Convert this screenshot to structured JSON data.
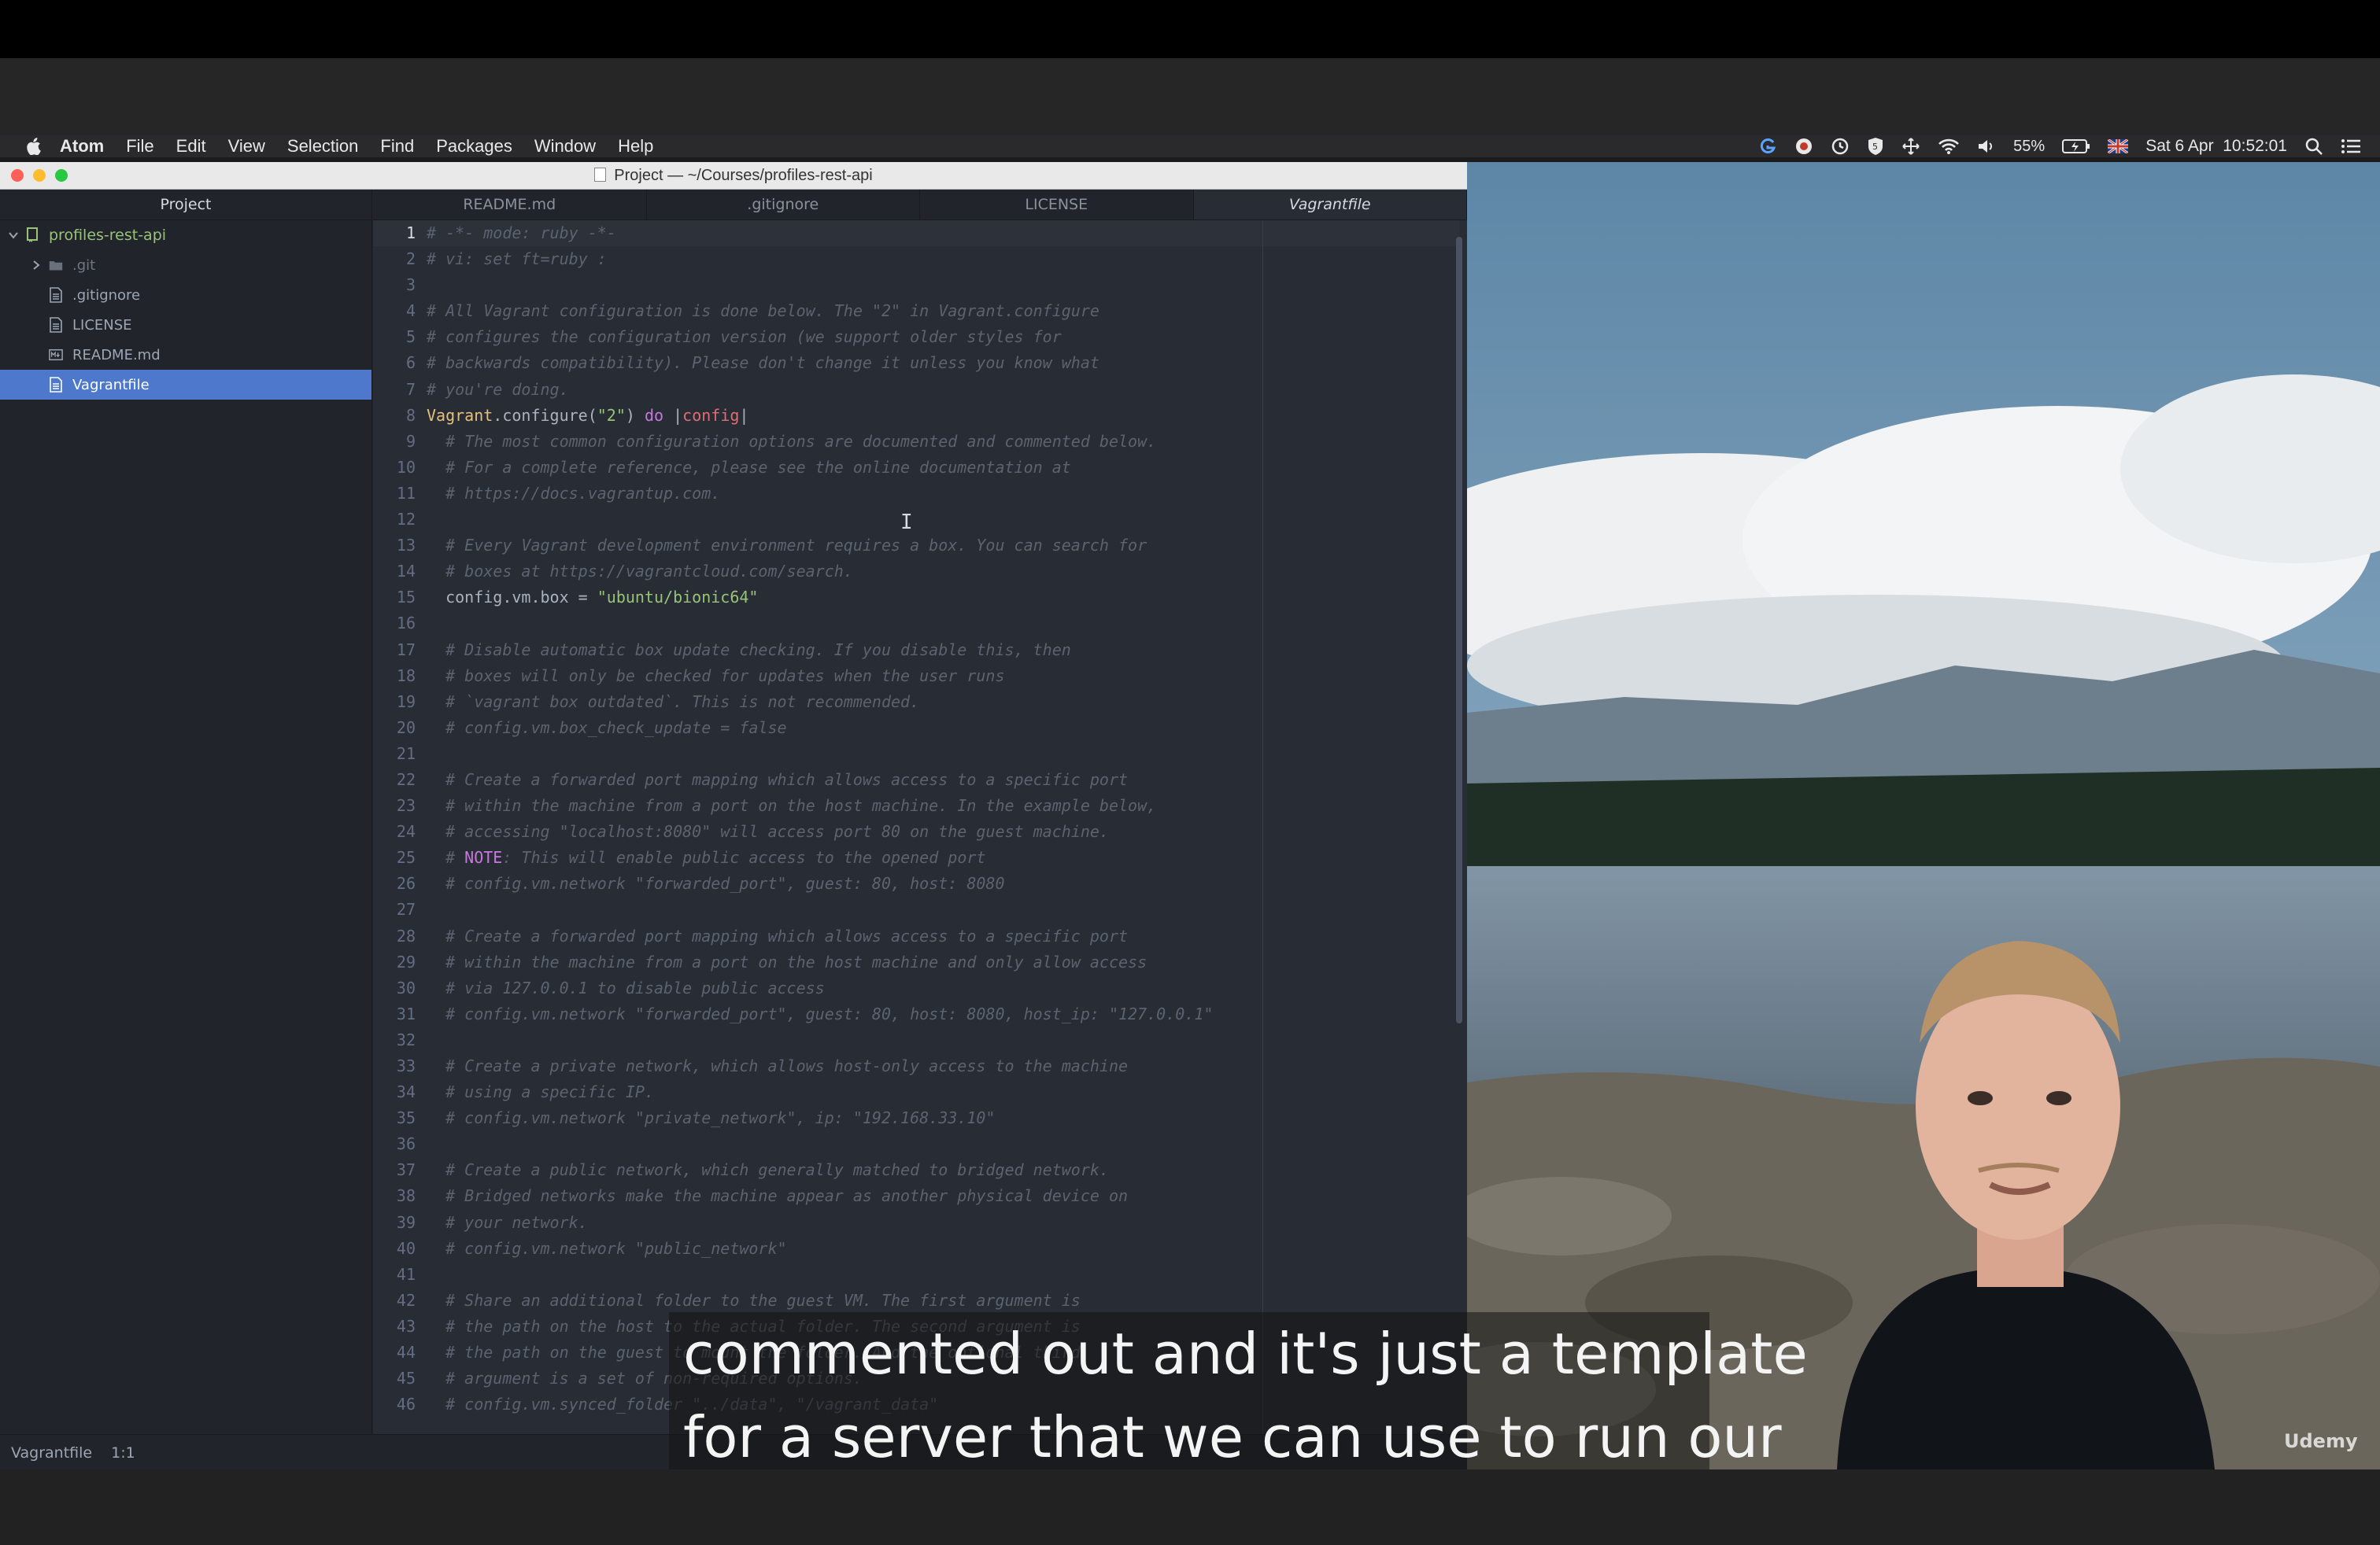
{
  "menubar": {
    "app_name": "Atom",
    "items": [
      "File",
      "Edit",
      "View",
      "Selection",
      "Find",
      "Packages",
      "Window",
      "Help"
    ],
    "battery": "55%",
    "datetime": "Sat 6 Apr  10:52:01"
  },
  "window": {
    "title": "Project — ~/Courses/profiles-rest-api"
  },
  "sidebar": {
    "header": "Project",
    "root": "profiles-rest-api",
    "items": [
      {
        "label": ".git",
        "type": "folder"
      },
      {
        "label": ".gitignore",
        "type": "file"
      },
      {
        "label": "LICENSE",
        "type": "file"
      },
      {
        "label": "README.md",
        "type": "markdown"
      },
      {
        "label": "Vagrantfile",
        "type": "file",
        "selected": true
      }
    ]
  },
  "tabs": [
    "README.md",
    ".gitignore",
    "LICENSE",
    "Vagrantfile"
  ],
  "active_tab": "Vagrantfile",
  "code": [
    [
      {
        "t": "# -*- mode: ruby -*-",
        "c": "cmt"
      }
    ],
    [
      {
        "t": "# vi: set ft=ruby :",
        "c": "cmt"
      }
    ],
    [],
    [
      {
        "t": "# All Vagrant configuration is done below. The \"2\" in Vagrant.configure",
        "c": "cmt"
      }
    ],
    [
      {
        "t": "# configures the configuration version (we support older styles for",
        "c": "cmt"
      }
    ],
    [
      {
        "t": "# backwards compatibility). Please don't change it unless you know what",
        "c": "cmt"
      }
    ],
    [
      {
        "t": "# you're doing.",
        "c": "cmt"
      }
    ],
    [
      {
        "t": "Vagrant",
        "c": "cls"
      },
      {
        "t": ".configure(",
        "c": "plain"
      },
      {
        "t": "\"2\"",
        "c": "str"
      },
      {
        "t": ") ",
        "c": "plain"
      },
      {
        "t": "do",
        "c": "kw"
      },
      {
        "t": " |",
        "c": "plain"
      },
      {
        "t": "config",
        "c": "var"
      },
      {
        "t": "|",
        "c": "plain"
      }
    ],
    [
      {
        "t": "  # The most common configuration options are documented and commented below.",
        "c": "cmt"
      }
    ],
    [
      {
        "t": "  # For a complete reference, please see the online documentation at",
        "c": "cmt"
      }
    ],
    [
      {
        "t": "  # https://docs.vagrantup.com.",
        "c": "cmt"
      }
    ],
    [],
    [
      {
        "t": "  # Every Vagrant development environment requires a box. You can search for",
        "c": "cmt"
      }
    ],
    [
      {
        "t": "  # boxes at https://vagrantcloud.com/search.",
        "c": "cmt"
      }
    ],
    [
      {
        "t": "  config.vm.box = ",
        "c": "plain"
      },
      {
        "t": "\"ubuntu/bionic64\"",
        "c": "str"
      }
    ],
    [],
    [
      {
        "t": "  # Disable automatic box update checking. If you disable this, then",
        "c": "cmt"
      }
    ],
    [
      {
        "t": "  # boxes will only be checked for updates when the user runs",
        "c": "cmt"
      }
    ],
    [
      {
        "t": "  # `vagrant box outdated`. This is not recommended.",
        "c": "cmt"
      }
    ],
    [
      {
        "t": "  # config.vm.box_check_update = false",
        "c": "cmt"
      }
    ],
    [],
    [
      {
        "t": "  # Create a forwarded port mapping which allows access to a specific port",
        "c": "cmt"
      }
    ],
    [
      {
        "t": "  # within the machine from a port on the host machine. In the example below,",
        "c": "cmt"
      }
    ],
    [
      {
        "t": "  # accessing \"localhost:8080\" will access port 80 on the guest machine.",
        "c": "cmt"
      }
    ],
    [
      {
        "t": "  # ",
        "c": "cmt"
      },
      {
        "t": "NOTE",
        "c": "kw"
      },
      {
        "t": ": This will enable public access to the opened port",
        "c": "cmt"
      }
    ],
    [
      {
        "t": "  # config.vm.network \"forwarded_port\", guest: 80, host: 8080",
        "c": "cmt"
      }
    ],
    [],
    [
      {
        "t": "  # Create a forwarded port mapping which allows access to a specific port",
        "c": "cmt"
      }
    ],
    [
      {
        "t": "  # within the machine from a port on the host machine and only allow access",
        "c": "cmt"
      }
    ],
    [
      {
        "t": "  # via 127.0.0.1 to disable public access",
        "c": "cmt"
      }
    ],
    [
      {
        "t": "  # config.vm.network \"forwarded_port\", guest: 80, host: 8080, host_ip: \"127.0.0.1\"",
        "c": "cmt"
      }
    ],
    [],
    [
      {
        "t": "  # Create a private network, which allows host-only access to the machine",
        "c": "cmt"
      }
    ],
    [
      {
        "t": "  # using a specific IP.",
        "c": "cmt"
      }
    ],
    [
      {
        "t": "  # config.vm.network \"private_network\", ip: \"192.168.33.10\"",
        "c": "cmt"
      }
    ],
    [],
    [
      {
        "t": "  # Create a public network, which generally matched to bridged network.",
        "c": "cmt"
      }
    ],
    [
      {
        "t": "  # Bridged networks make the machine appear as another physical device on",
        "c": "cmt"
      }
    ],
    [
      {
        "t": "  # your network.",
        "c": "cmt"
      }
    ],
    [
      {
        "t": "  # config.vm.network \"public_network\"",
        "c": "cmt"
      }
    ],
    [],
    [
      {
        "t": "  # Share an additional folder to the guest VM. The first argument is",
        "c": "cmt"
      }
    ],
    [
      {
        "t": "  # the path on the host to the actual folder. The second argument is",
        "c": "cmt"
      }
    ],
    [
      {
        "t": "  # the path on the guest to mount the folder. And the optional third",
        "c": "cmt"
      }
    ],
    [
      {
        "t": "  # argument is a set of non-required options.",
        "c": "cmt"
      }
    ],
    [
      {
        "t": "  # config.vm.synced_folder \"../data\", \"/vagrant_data\"",
        "c": "cmt"
      }
    ]
  ],
  "statusbar": {
    "file": "Vagrantfile",
    "position": "1:1"
  },
  "caption": {
    "line1": "commented out and it's just a template",
    "line2": "for a server that we can use to run our"
  },
  "watermark": "Udemy",
  "colors": {
    "selection": "#4d78cc",
    "editor_bg": "#282c34",
    "sidebar_bg": "#21252b",
    "string": "#98c379",
    "keyword": "#c678dd",
    "comment": "#5c6370"
  }
}
